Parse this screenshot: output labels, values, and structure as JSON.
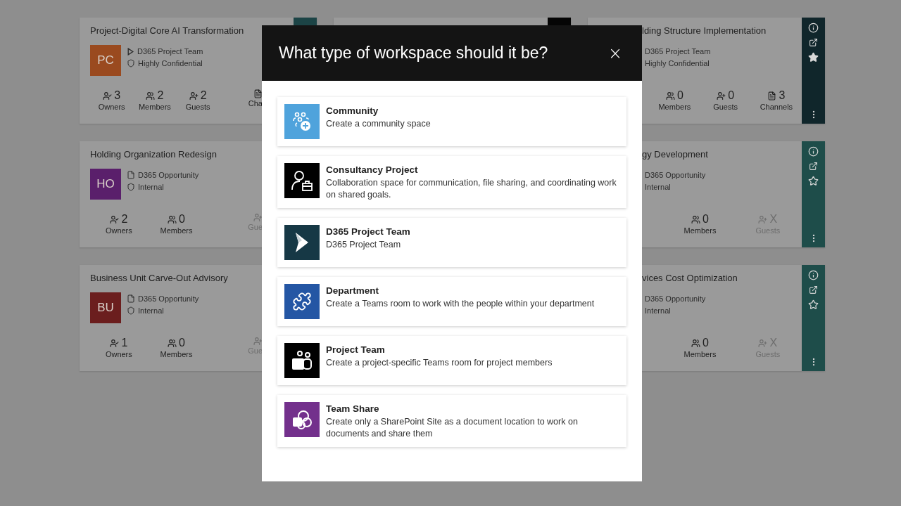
{
  "rows": [
    {
      "left": {
        "title": "Project-Digital Core AI Transformation",
        "initials": "PC",
        "color": "#9a4a1f",
        "type": {
          "kind": "project",
          "label": "D365 Project Team"
        },
        "classification": "Highly Confidential",
        "rail": {
          "color": "#1c4446"
        },
        "stats": [
          {
            "kind": "owners",
            "value": "3",
            "label": "Owners",
            "disabled": false
          },
          {
            "kind": "members",
            "value": "2",
            "label": "Members",
            "disabled": false
          },
          {
            "kind": "guests",
            "value": "2",
            "label": "Guests",
            "disabled": false
          },
          {
            "kind": "channels-partial",
            "label": "Cha",
            "disabled": false
          }
        ]
      },
      "middle": {
        "rail": {
          "color": "#050505"
        }
      },
      "right": {
        "title": "lding Structure Implementation",
        "type": "D365 Project Team",
        "classification": "Highly Confidential",
        "color": "#10262b",
        "favorite": true,
        "stats": [
          {
            "kind": "members",
            "value": "0",
            "label": "Members",
            "disabled": false
          },
          {
            "kind": "guests",
            "value": "0",
            "label": "Guests",
            "disabled": false
          },
          {
            "kind": "channels",
            "value": "3",
            "label": "Channels",
            "disabled": false
          }
        ]
      }
    },
    {
      "left": {
        "title": "Holding Organization Redesign",
        "initials": "HO",
        "color": "#5a1f6b",
        "type": {
          "kind": "opportunity",
          "label": "D365 Opportunity"
        },
        "classification": "Internal",
        "stats": [
          {
            "kind": "owners",
            "value": "2",
            "label": "Owners",
            "disabled": false
          },
          {
            "kind": "members",
            "value": "0",
            "label": "Members",
            "disabled": false
          },
          {
            "kind": "guests-partial",
            "label": "Gue",
            "disabled": true
          }
        ]
      },
      "right": {
        "title": "gy Development",
        "type": "D365 Opportunity",
        "classification": "Internal",
        "color": "#1e4d4a",
        "favorite": false,
        "stats": [
          {
            "kind": "members",
            "value": "0",
            "label": "Members",
            "disabled": false
          },
          {
            "kind": "guests",
            "value": "X",
            "label": "Guests",
            "disabled": true
          }
        ]
      }
    },
    {
      "left": {
        "title": "Business Unit Carve-Out Advisory",
        "initials": "BU",
        "color": "#6b1e1e",
        "type": {
          "kind": "opportunity",
          "label": "D365 Opportunity"
        },
        "classification": "Internal",
        "stats": [
          {
            "kind": "owners",
            "value": "1",
            "label": "Owners",
            "disabled": false
          },
          {
            "kind": "members",
            "value": "0",
            "label": "Members",
            "disabled": false
          },
          {
            "kind": "guests-partial",
            "label": "Gue",
            "disabled": true
          }
        ]
      },
      "right": {
        "title": "vices Cost Optimization",
        "type": "D365 Opportunity",
        "classification": "Internal",
        "color": "#1e4d4a",
        "favorite": false,
        "stats": [
          {
            "kind": "members",
            "value": "0",
            "label": "Members",
            "disabled": false
          },
          {
            "kind": "guests",
            "value": "X",
            "label": "Guests",
            "disabled": true
          }
        ]
      }
    }
  ],
  "dialog": {
    "title": "What type of workspace should it be?",
    "close": "×",
    "options": [
      {
        "title": "Community",
        "description": "Create a community space",
        "color": "#4fa3dc"
      },
      {
        "title": "Consultancy Project",
        "description": "Collaboration space for communication, file sharing, and coordinating work on shared goals.",
        "color": "#000000"
      },
      {
        "title": "D365 Project Team",
        "description": "D365 Project Team",
        "color": "#163845"
      },
      {
        "title": "Department",
        "description": "Create a Teams room to work with the people within your department",
        "color": "#2456a4"
      },
      {
        "title": "Project Team",
        "description": "Create a project-specific Teams room for project members",
        "color": "#000000"
      },
      {
        "title": "Team Share",
        "description": "Create only a SharePoint Site as a document location to work on documents and share them",
        "color": "#73308c"
      }
    ]
  }
}
